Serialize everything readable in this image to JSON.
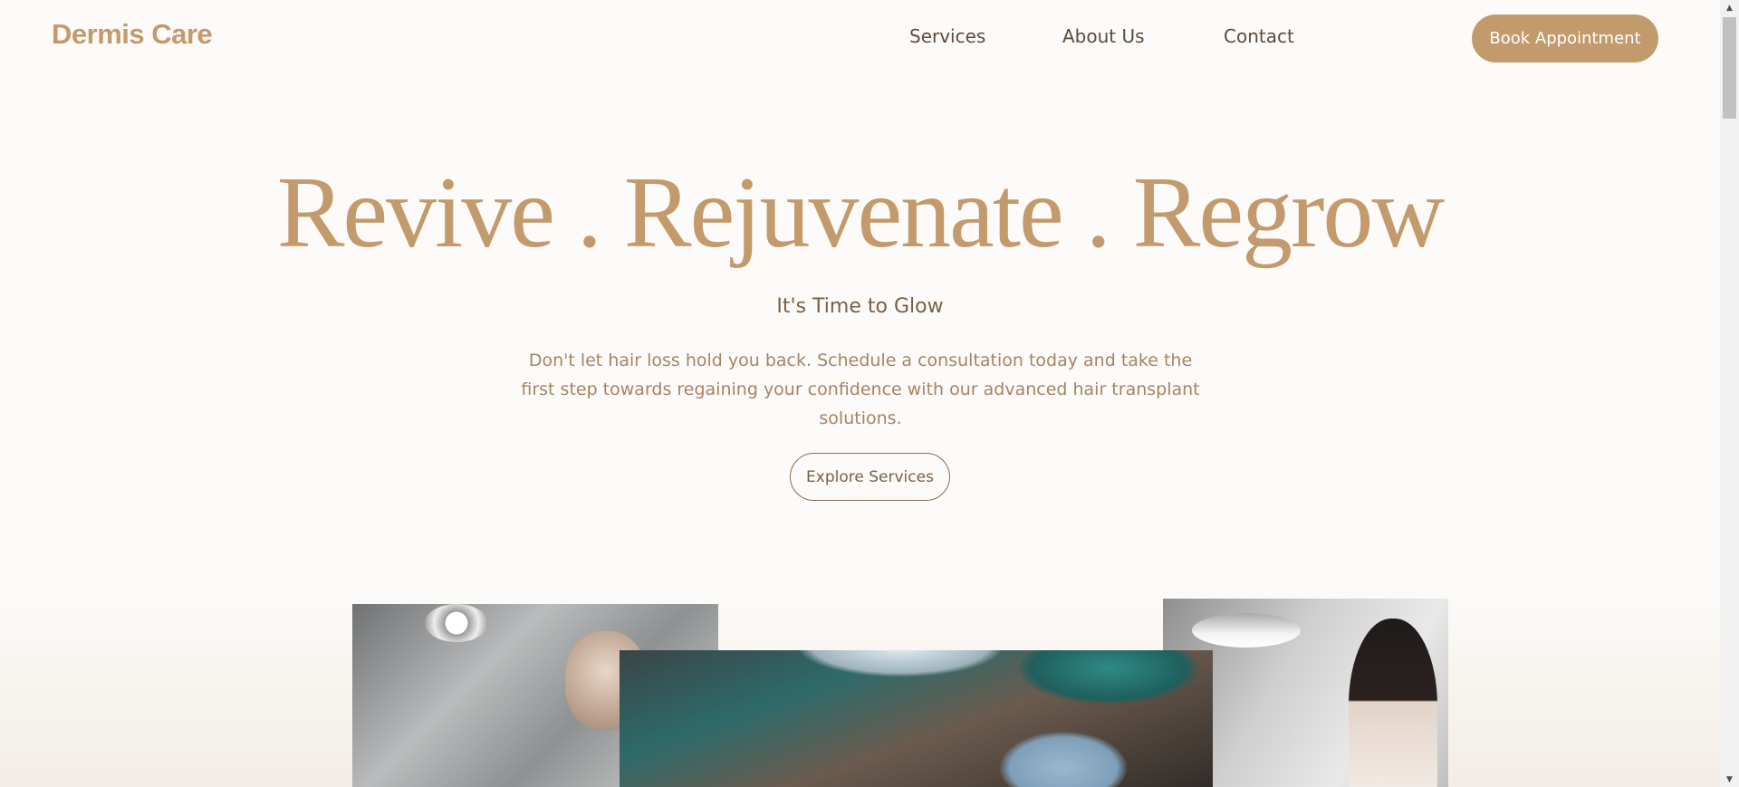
{
  "header": {
    "logo": "Dermis Care",
    "nav": [
      {
        "label": "Services"
      },
      {
        "label": "About Us"
      },
      {
        "label": "Contact"
      }
    ],
    "cta": "Book Appointment"
  },
  "hero": {
    "title": "Revive . Rejuvenate . Regrow",
    "subtitle": "It's Time to Glow",
    "body": "Don't let hair loss hold you back. Schedule a consultation today and take the first step towards regaining your confidence with our advanced hair transplant solutions.",
    "button": "Explore Services"
  },
  "colors": {
    "accent": "#c39a6b",
    "text": "#7a5f45",
    "background": "#fdfbf9"
  }
}
